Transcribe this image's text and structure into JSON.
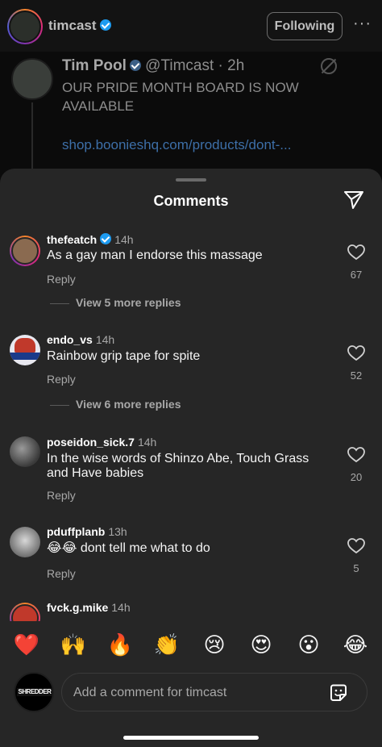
{
  "header": {
    "username": "timcast",
    "follow_label": "Following",
    "more_label": "···"
  },
  "post": {
    "author": "Tim Pool",
    "handle_time": "@Timcast · 2h",
    "body": "OUR PRIDE MONTH BOARD IS NOW AVAILABLE",
    "link": "shop.boonieshq.com/products/dont-..."
  },
  "sheet": {
    "title": "Comments"
  },
  "comments": [
    {
      "user": "thefeatch",
      "verified": true,
      "time": "14h",
      "text": "As a gay man I endorse this massage",
      "reply": "Reply",
      "likes": "67",
      "view_replies": "View 5 more replies",
      "avatar_color": "#8a6a50"
    },
    {
      "user": "endo_vs",
      "verified": false,
      "time": "14h",
      "text": "Rainbow grip tape for spite",
      "reply": "Reply",
      "likes": "52",
      "view_replies": "View 6 more replies",
      "avatar_color": "#e8e8f0"
    },
    {
      "user": "poseidon_sick.7",
      "verified": false,
      "time": "14h",
      "text": "In the wise words of Shinzo Abe, Touch Grass and Have babies",
      "reply": "Reply",
      "likes": "20",
      "avatar_color": "#6b6b6b"
    },
    {
      "user": "pduffplanb",
      "verified": false,
      "time": "13h",
      "text": "😂😂 dont tell me what to do",
      "reply": "Reply",
      "likes": "5",
      "avatar_color": "#9a9a9a"
    },
    {
      "user": "fvck.g.mike",
      "verified": false,
      "time": "14h",
      "avatar_color": "#c0392b"
    }
  ],
  "emoji_reactions": [
    "❤️",
    "🙌",
    "🔥",
    "👏",
    "😢",
    "😍",
    "😮",
    "😂"
  ],
  "compose": {
    "avatar_text": "SHREDDER",
    "placeholder": "Add a comment for timcast"
  }
}
